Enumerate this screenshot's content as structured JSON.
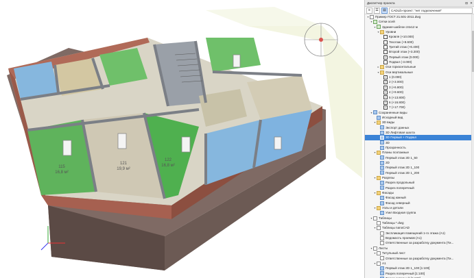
{
  "panel": {
    "title": "Диспетчер проекта",
    "project_selector": "CADLib-проект: \"нет подключения\"",
    "tree": [
      {
        "label": "Пример ГОСТ 21.501-2011.dwg",
        "indent": 0,
        "arrow": "▾",
        "icon": "sheet"
      },
      {
        "label": "Сетки осей",
        "indent": 1,
        "arrow": "▾",
        "icon": "grid"
      },
      {
        "label": "Здание-шаблон 24x12 м",
        "indent": 2,
        "arrow": "▾",
        "icon": "grid"
      },
      {
        "label": "Уровни",
        "indent": 3,
        "arrow": "▾",
        "icon": "folder"
      },
      {
        "label": "Кровля (+10.000)",
        "indent": 4,
        "arrow": "",
        "icon": "check",
        "checked": false
      },
      {
        "label": "Техэтаж (+8.600)",
        "indent": 4,
        "arrow": "",
        "icon": "check",
        "checked": false
      },
      {
        "label": "Третий этаж (+6.400)",
        "indent": 4,
        "arrow": "",
        "icon": "check",
        "checked": false
      },
      {
        "label": "Второй этаж (+3.200)",
        "indent": 4,
        "arrow": "",
        "icon": "check",
        "checked": false
      },
      {
        "label": "Первый этаж (0.000)",
        "indent": 4,
        "arrow": "",
        "icon": "check",
        "checked": true
      },
      {
        "label": "Подвал (-3.000)",
        "indent": 4,
        "arrow": "",
        "icon": "check",
        "checked": false
      },
      {
        "label": "Оси горизонтальные",
        "indent": 3,
        "arrow": "▸",
        "icon": "folder"
      },
      {
        "label": "Оси вертикальные",
        "indent": 3,
        "arrow": "▾",
        "icon": "folder"
      },
      {
        "label": "1 (0.000)",
        "indent": 4,
        "arrow": "",
        "icon": "check",
        "checked": true
      },
      {
        "label": "2 (+3.000)",
        "indent": 4,
        "arrow": "",
        "icon": "check",
        "checked": true
      },
      {
        "label": "3 (+6.800)",
        "indent": 4,
        "arrow": "",
        "icon": "check",
        "checked": true
      },
      {
        "label": "4 (+9.600)",
        "indent": 4,
        "arrow": "",
        "icon": "check",
        "checked": true
      },
      {
        "label": "5 (+13.800)",
        "indent": 4,
        "arrow": "",
        "icon": "check",
        "checked": true
      },
      {
        "label": "6 (+16.800)",
        "indent": 4,
        "arrow": "",
        "icon": "check",
        "checked": true
      },
      {
        "label": "7 (+17.700)",
        "indent": 4,
        "arrow": "",
        "icon": "check",
        "checked": true
      },
      {
        "label": "Сохраненные виды",
        "indent": 1,
        "arrow": "▾",
        "icon": "view"
      },
      {
        "label": "Исходный вид",
        "indent": 2,
        "arrow": "",
        "icon": "view"
      },
      {
        "label": "3D виды",
        "indent": 2,
        "arrow": "▾",
        "icon": "folder"
      },
      {
        "label": "Экспорт данных",
        "indent": 3,
        "arrow": "",
        "icon": "view"
      },
      {
        "label": "3D Лифтовая шахта",
        "indent": 3,
        "arrow": "",
        "icon": "view"
      },
      {
        "label": "3D Первый + Подвал",
        "indent": 3,
        "arrow": "",
        "icon": "view",
        "selected": true
      },
      {
        "label": "3D",
        "indent": 3,
        "arrow": "",
        "icon": "view"
      },
      {
        "label": "Прозрачность",
        "indent": 3,
        "arrow": "",
        "icon": "view"
      },
      {
        "label": "Планы поэтажные",
        "indent": 2,
        "arrow": "▾",
        "icon": "folder"
      },
      {
        "label": "Первый этаж 2D 1_50",
        "indent": 3,
        "arrow": "",
        "icon": "view"
      },
      {
        "label": "2D",
        "indent": 3,
        "arrow": "",
        "icon": "view"
      },
      {
        "label": "Первый этаж 2D 1_100",
        "indent": 3,
        "arrow": "",
        "icon": "view"
      },
      {
        "label": "Первый этаж 2D 1_200",
        "indent": 3,
        "arrow": "",
        "icon": "view"
      },
      {
        "label": "Разрезы",
        "indent": 2,
        "arrow": "▾",
        "icon": "folder"
      },
      {
        "label": "Разрез продольный",
        "indent": 3,
        "arrow": "",
        "icon": "view"
      },
      {
        "label": "Разрез поперечный",
        "indent": 3,
        "arrow": "",
        "icon": "view"
      },
      {
        "label": "Фасады",
        "indent": 2,
        "arrow": "▾",
        "icon": "folder"
      },
      {
        "label": "Фасад южный",
        "indent": 3,
        "arrow": "",
        "icon": "view"
      },
      {
        "label": "Фасад северный",
        "indent": 3,
        "arrow": "",
        "icon": "view"
      },
      {
        "label": "Узлы и детали",
        "indent": 2,
        "arrow": "▾",
        "icon": "folder"
      },
      {
        "label": "Узел Входная группа",
        "indent": 3,
        "arrow": "",
        "icon": "view"
      },
      {
        "label": "Таблицы",
        "indent": 1,
        "arrow": "▾",
        "icon": "sheet"
      },
      {
        "label": "Таблицы *.dwg",
        "indent": 2,
        "arrow": "",
        "icon": "sheet"
      },
      {
        "label": "Таблицы nanoCAD",
        "indent": 2,
        "arrow": "▾",
        "icon": "sheet"
      },
      {
        "label": "Экспликация помещений 1-го этажа (А1)",
        "indent": 3,
        "arrow": "",
        "icon": "sheet"
      },
      {
        "label": "Ведомость проемов (А1)",
        "indent": 3,
        "arrow": "",
        "icon": "sheet"
      },
      {
        "label": "Ответственные за разработку документа (Ти...",
        "indent": 3,
        "arrow": "",
        "icon": "sheet"
      },
      {
        "label": "Листы",
        "indent": 1,
        "arrow": "▾",
        "icon": "sheet"
      },
      {
        "label": "Титульный лист",
        "indent": 2,
        "arrow": "▾",
        "icon": "sheet"
      },
      {
        "label": "Ответственные за разработку документа (Ти...",
        "indent": 3,
        "arrow": "",
        "icon": "sheet"
      },
      {
        "label": "А1",
        "indent": 2,
        "arrow": "▾",
        "icon": "sheet"
      },
      {
        "label": "Первый этаж 2D 1_100 [1:100]",
        "indent": 3,
        "arrow": "",
        "icon": "view"
      },
      {
        "label": "Разрез поперечный [1:100]",
        "indent": 3,
        "arrow": "",
        "icon": "view"
      },
      {
        "label": "Фасад северный [1:100]",
        "indent": 3,
        "arrow": "",
        "icon": "view"
      },
      {
        "label": "3D 3D0001",
        "indent": 3,
        "arrow": "",
        "icon": "view"
      }
    ]
  },
  "rooms": [
    {
      "number": "115",
      "area": "16,8 м²"
    },
    {
      "number": "121",
      "area": "19,9 м²"
    },
    {
      "number": "122",
      "area": "16,8 м²"
    }
  ],
  "colors": {
    "brick": "#9a5a4a",
    "floor_green": "#4fb04f",
    "floor_blue": "#86b7de",
    "floor_beige": "#c8c2a8",
    "wall_grey": "#8f9298",
    "selection": "#3b83d6"
  }
}
